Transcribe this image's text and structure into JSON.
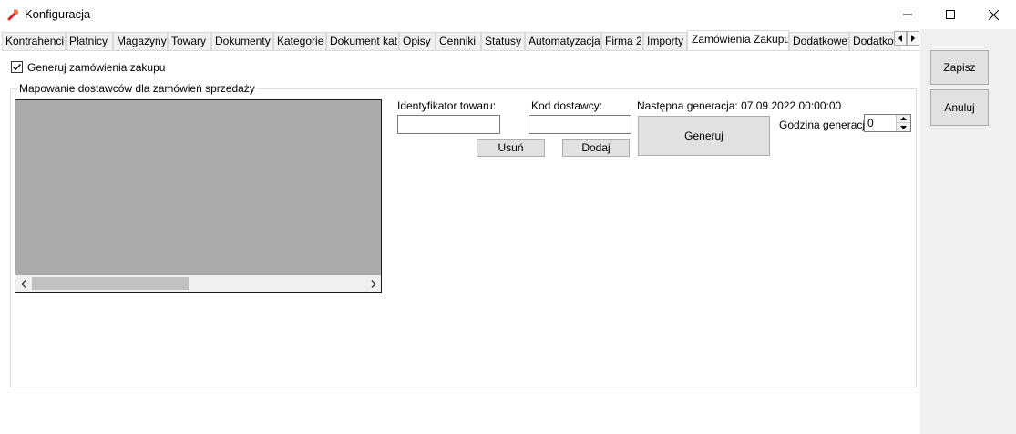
{
  "window": {
    "title": "Konfiguracja",
    "icon": "wrench-icon",
    "controls": {
      "minimize": "minimize-icon",
      "maximize": "maximize-icon",
      "close": "close-icon"
    }
  },
  "tabs": [
    {
      "label": "Kontrahenci"
    },
    {
      "label": "Płatnicy"
    },
    {
      "label": "Magazyny"
    },
    {
      "label": "Towary"
    },
    {
      "label": "Dokumenty"
    },
    {
      "label": "Kategorie"
    },
    {
      "label": "Dokument kat"
    },
    {
      "label": "Opisy"
    },
    {
      "label": "Cenniki"
    },
    {
      "label": "Statusy"
    },
    {
      "label": "Automatyzacja"
    },
    {
      "label": "Firma 2"
    },
    {
      "label": "Importy"
    },
    {
      "label": "Zamówienia Zakupu",
      "active": true
    },
    {
      "label": "Dodatkowe"
    },
    {
      "label": "Dodatkowe"
    }
  ],
  "side_buttons": {
    "save": "Zapisz",
    "cancel": "Anuluj"
  },
  "page": {
    "generate_checkbox": {
      "label": "Generuj zamówienia zakupu",
      "checked": true
    },
    "group_title": "Mapowanie dostawców dla zamówień sprzedaży",
    "item_id_label": "Identyfikator towaru:",
    "item_id_value": "",
    "supplier_code_label": "Kod dostawcy:",
    "supplier_code_value": "",
    "remove_button": "Usuń",
    "add_button": "Dodaj",
    "next_generation": "Następna generacja: 07.09.2022 00:00:00",
    "generate_button": "Generuj",
    "hour_label": "Godzina generacji",
    "hour_value": "0"
  },
  "colors": {
    "grid_background": "#ababab",
    "window_background": "#f0f0f0"
  }
}
